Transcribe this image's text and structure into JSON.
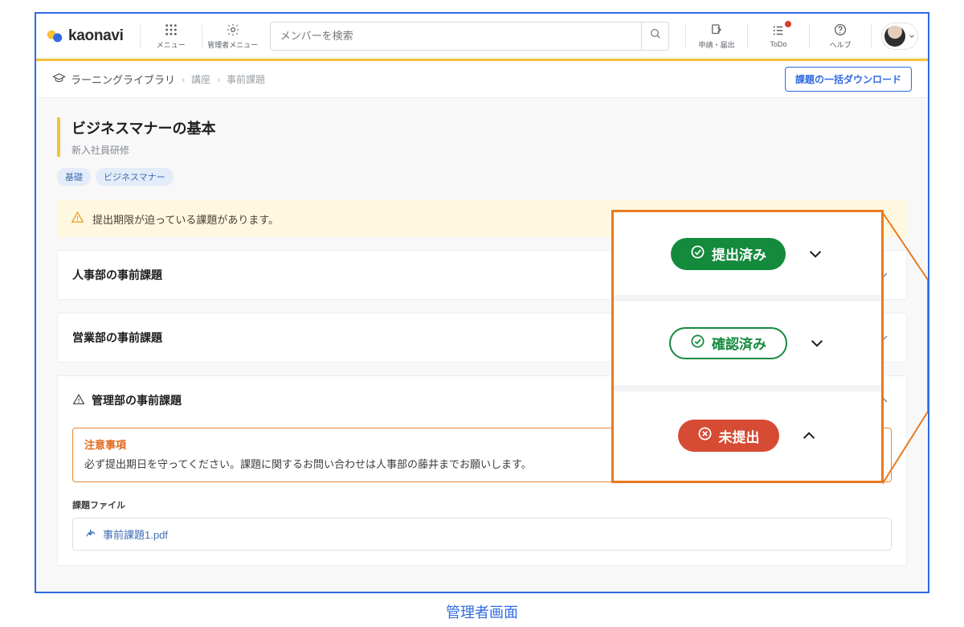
{
  "caption": "管理者画面",
  "header": {
    "logo_text": "kaonavi",
    "menu_label": "メニュー",
    "admin_menu_label": "管理者メニュー",
    "search_placeholder": "メンバーを検索",
    "apply_label": "申請・届出",
    "todo_label": "ToDo",
    "help_label": "ヘルプ"
  },
  "breadcrumb": {
    "root": "ラーニングライブラリ",
    "level2": "講座",
    "level3": "事前課題",
    "bulk_download": "課題の一括ダウンロード"
  },
  "page": {
    "title": "ビジネスマナーの基本",
    "subtitle": "新入社員研修",
    "tags": [
      "基礎",
      "ビジネスマナー"
    ],
    "alert": "提出期限が迫っている課題があります。"
  },
  "tasks": [
    {
      "title": "人事部の事前課題"
    },
    {
      "title": "営業部の事前課題"
    },
    {
      "title": "管理部の事前課題"
    }
  ],
  "notice": {
    "heading": "注意事項",
    "body": "必ず提出期日を守ってください。課題に関するお問い合わせは人事部の藤井までお願いします。"
  },
  "files": {
    "label": "課題ファイル",
    "items": [
      "事前課題1.pdf"
    ]
  },
  "callout": {
    "submitted": "提出済み",
    "confirmed": "確認済み",
    "unsubmitted": "未提出"
  }
}
